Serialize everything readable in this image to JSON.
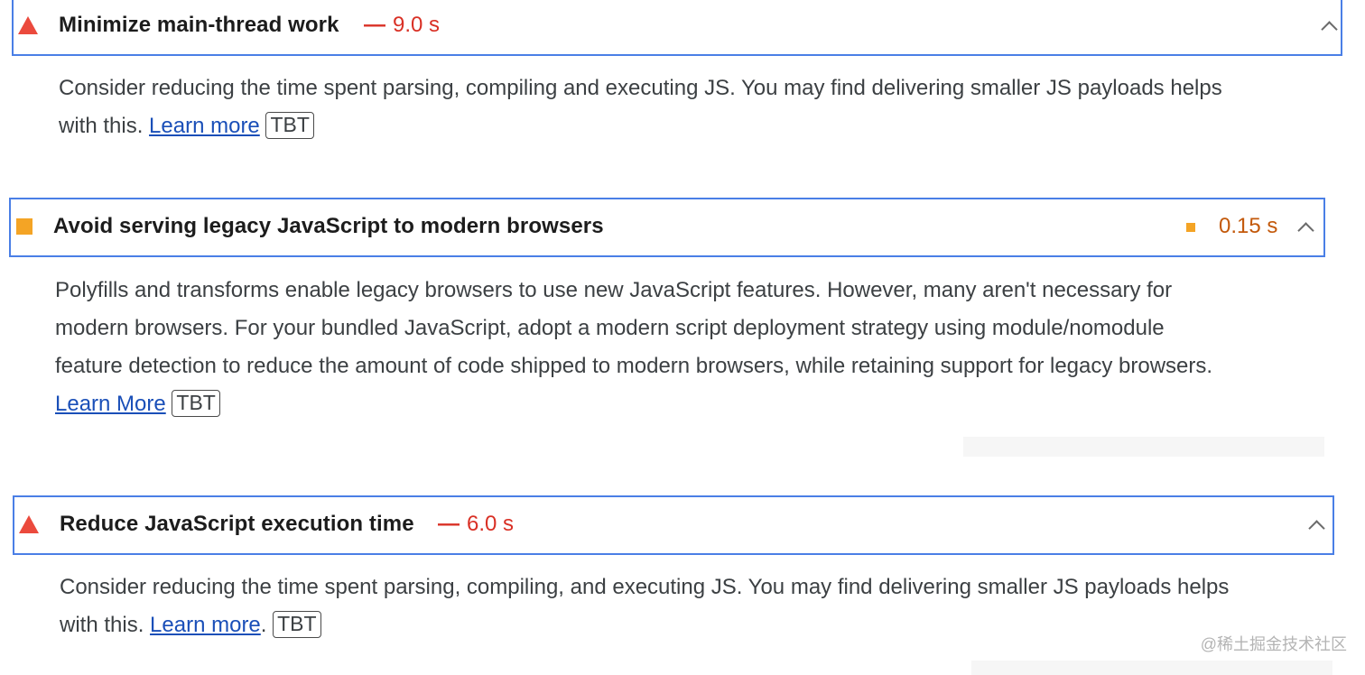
{
  "audits": [
    {
      "title": "Minimize main-thread work",
      "separator": "—",
      "value": "9.0 s",
      "description_lines": [
        "Consider reducing the time spent parsing, compiling and executing JS. You may find delivering smaller JS payloads helps",
        "with this."
      ],
      "link_label": "Learn more",
      "tag": "TBT",
      "status": "fail",
      "status_color": "#eb4a3d",
      "value_color": "#d93025"
    },
    {
      "title": "Avoid serving legacy JavaScript to modern browsers",
      "value": "0.15 s",
      "description_lines": [
        "Polyfills and transforms enable legacy browsers to use new JavaScript features. However, many aren't necessary for",
        "modern browsers. For your bundled JavaScript, adopt a modern script deployment strategy using module/nomodule",
        "feature detection to reduce the amount of code shipped to modern browsers, while retaining support for legacy browsers."
      ],
      "link_label": "Learn More",
      "tag": "TBT",
      "status": "average",
      "status_color": "#f4a425",
      "value_color": "#c3590b"
    },
    {
      "title": "Reduce JavaScript execution time",
      "separator": "—",
      "value": "6.0 s",
      "description_lines": [
        "Consider reducing the time spent parsing, compiling, and executing JS. You may find delivering smaller JS payloads helps",
        "with this."
      ],
      "link_label": "Learn more",
      "link_suffix": ".",
      "tag": "TBT",
      "status": "fail",
      "status_color": "#eb4a3d",
      "value_color": "#d93025"
    }
  ],
  "accent_border_color": "#4a7fe6",
  "icons": {
    "fail": "warning-triangle-icon",
    "average": "average-square-icon",
    "collapse": "chevron-up-icon"
  },
  "watermark": "@稀土掘金技术社区"
}
